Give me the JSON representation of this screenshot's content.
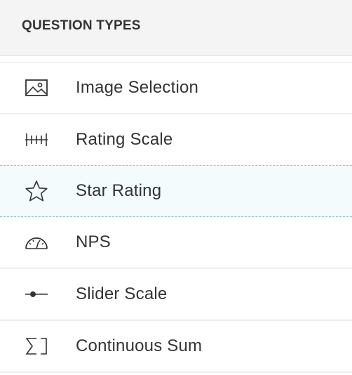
{
  "panel": {
    "title": "QUESTION TYPES"
  },
  "items": [
    {
      "label": "Image Selection",
      "icon": "image-icon"
    },
    {
      "label": "Rating Scale",
      "icon": "rating-scale-icon"
    },
    {
      "label": "Star Rating",
      "icon": "star-icon",
      "selected": true
    },
    {
      "label": "NPS",
      "icon": "gauge-icon"
    },
    {
      "label": "Slider Scale",
      "icon": "slider-icon"
    },
    {
      "label": "Continuous Sum",
      "icon": "sum-icon"
    }
  ],
  "colors": {
    "header_bg": "#f4f4f4",
    "selected_bg": "#f3fbfc",
    "selected_border": "#93c2d4",
    "text": "#333333"
  }
}
